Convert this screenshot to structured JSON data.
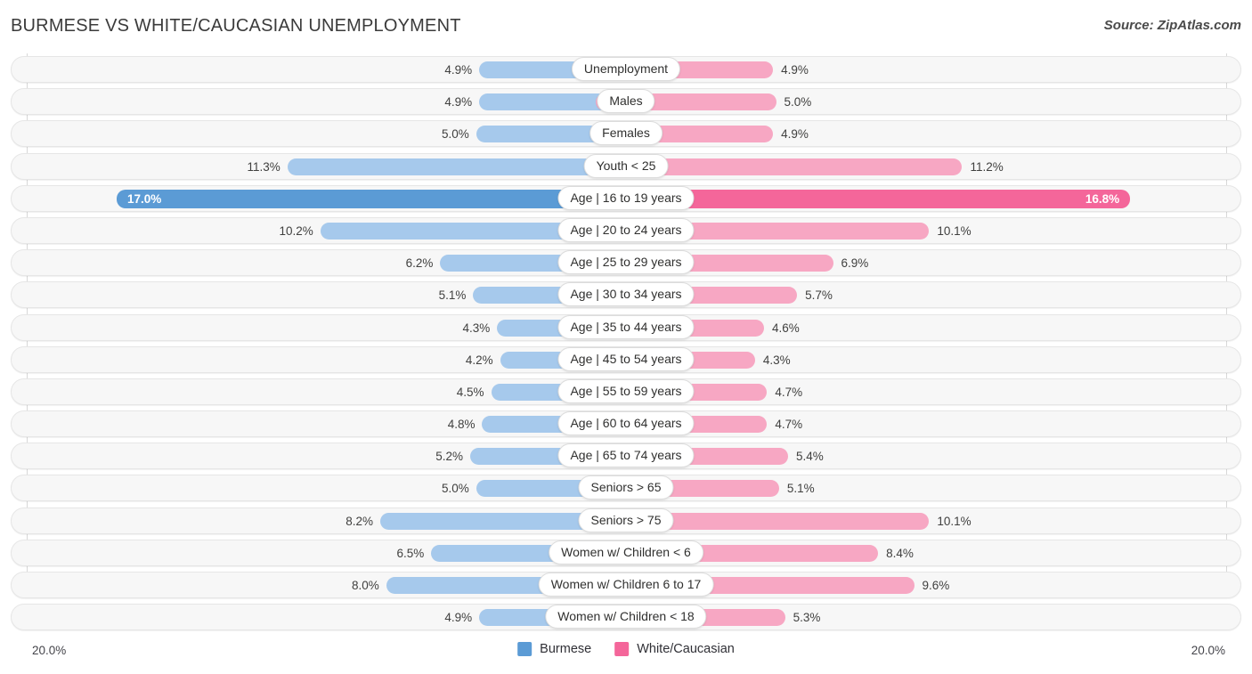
{
  "header": {
    "title": "BURMESE VS WHITE/CAUCASIAN UNEMPLOYMENT",
    "source": "Source: ZipAtlas.com"
  },
  "axis": {
    "left_label": "20.0%",
    "right_label": "20.0%",
    "max": 20.0
  },
  "legend": {
    "items": [
      {
        "label": "Burmese",
        "color": "#5b9bd5"
      },
      {
        "label": "White/Caucasian",
        "color": "#f4669a"
      }
    ]
  },
  "colors": {
    "left_bar": "#a6c9ec",
    "right_bar": "#f7a7c3",
    "left_bar_highlight": "#5b9bd5",
    "right_bar_highlight": "#f4669a",
    "track": "#f7f7f7"
  },
  "chart_data": {
    "type": "bar",
    "title": "BURMESE VS WHITE/CAUCASIAN UNEMPLOYMENT",
    "subtitle": "",
    "xlabel": "",
    "ylabel": "",
    "orientation": "horizontal",
    "layout": "diverging-bidirectional",
    "grid": true,
    "legend_position": "bottom-center",
    "xlim": [
      20.0,
      20.0
    ],
    "axis_tick_labels": [
      "20.0%",
      "20.0%"
    ],
    "categories": [
      "Unemployment",
      "Males",
      "Females",
      "Youth < 25",
      "Age | 16 to 19 years",
      "Age | 20 to 24 years",
      "Age | 25 to 29 years",
      "Age | 30 to 34 years",
      "Age | 35 to 44 years",
      "Age | 45 to 54 years",
      "Age | 55 to 59 years",
      "Age | 60 to 64 years",
      "Age | 65 to 74 years",
      "Seniors > 65",
      "Seniors > 75",
      "Women w/ Children < 6",
      "Women w/ Children 6 to 17",
      "Women w/ Children < 18"
    ],
    "series": [
      {
        "name": "Burmese",
        "side": "left",
        "color": "#a6c9ec",
        "values": [
          4.9,
          4.9,
          5.0,
          11.3,
          17.0,
          10.2,
          6.2,
          5.1,
          4.3,
          4.2,
          4.5,
          4.8,
          5.2,
          5.0,
          8.2,
          6.5,
          8.0,
          4.9
        ],
        "labels": [
          "4.9%",
          "4.9%",
          "5.0%",
          "11.3%",
          "17.0%",
          "10.2%",
          "6.2%",
          "5.1%",
          "4.3%",
          "4.2%",
          "4.5%",
          "4.8%",
          "5.2%",
          "5.0%",
          "8.2%",
          "6.5%",
          "8.0%",
          "4.9%"
        ]
      },
      {
        "name": "White/Caucasian",
        "side": "right",
        "color": "#f7a7c3",
        "values": [
          4.9,
          5.0,
          4.9,
          11.2,
          16.8,
          10.1,
          6.9,
          5.7,
          4.6,
          4.3,
          4.7,
          4.7,
          5.4,
          5.1,
          10.1,
          8.4,
          9.6,
          5.3
        ],
        "labels": [
          "4.9%",
          "5.0%",
          "4.9%",
          "11.2%",
          "16.8%",
          "10.1%",
          "6.9%",
          "5.7%",
          "4.6%",
          "4.3%",
          "4.7%",
          "4.7%",
          "5.4%",
          "5.1%",
          "10.1%",
          "8.4%",
          "9.6%",
          "5.3%"
        ]
      }
    ],
    "highlight_row_index": 4
  }
}
